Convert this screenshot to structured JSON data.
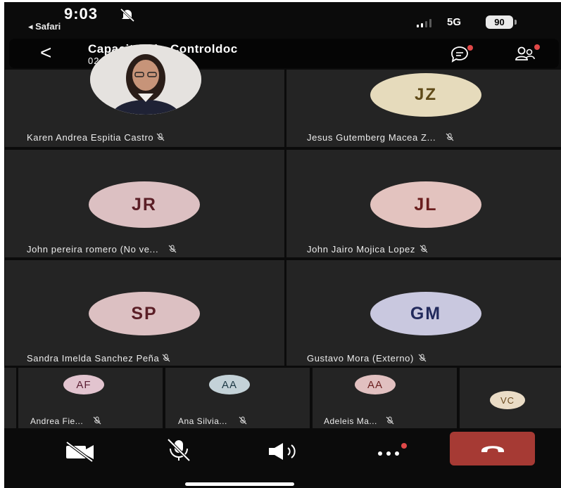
{
  "status_bar": {
    "time": "9:03",
    "back_app": "◂ Safari",
    "network": "5G",
    "battery": "90"
  },
  "call": {
    "title": "Capacitación  Controldoc",
    "timer": "02:45",
    "back_label": "<"
  },
  "participants": [
    {
      "name": "Karen Andrea Espitia Castro",
      "initials": "",
      "has_photo": true
    },
    {
      "name": "Jesus Gutemberg Macea Z...",
      "initials": "JZ",
      "avatar_color": "#e6dbbc",
      "text_color": "#5f4a18"
    },
    {
      "name": "John pereira romero (No ve...",
      "initials": "JR",
      "avatar_color": "#dcc0c2",
      "text_color": "#5a1e26"
    },
    {
      "name": "John Jairo Mojica Lopez",
      "initials": "JL",
      "avatar_color": "#e3c3bf",
      "text_color": "#6a1e1e"
    },
    {
      "name": "Sandra Imelda Sanchez Peña",
      "initials": "SP",
      "avatar_color": "#dcc0c2",
      "text_color": "#5a1e26"
    },
    {
      "name": "Gustavo Mora (Externo)",
      "initials": "GM",
      "avatar_color": "#c9c8df",
      "text_color": "#222a5c"
    }
  ],
  "strip": [
    {
      "name": "Andrea Fie...",
      "initials": "AF",
      "avatar_color": "#e2c4cf",
      "text_color": "#5a1e33"
    },
    {
      "name": "Ana Silvia...",
      "initials": "AA",
      "avatar_color": "#c4d2d8",
      "text_color": "#1c3844"
    },
    {
      "name": "Adeleis Ma...",
      "initials": "AA",
      "avatar_color": "#e1c0c0",
      "text_color": "#6a1e1e"
    },
    {
      "name": "",
      "initials": "VC",
      "avatar_color": "#eadcc6",
      "text_color": "#6a4a1e"
    }
  ],
  "controls": {
    "camera": "camera-off-icon",
    "mic": "mic-off-icon",
    "speaker": "speaker-icon",
    "more": "more-icon",
    "hangup": "hangup-icon"
  },
  "colors": {
    "hangup": "#a63a34",
    "notification": "#e04848",
    "tile": "#242424"
  }
}
